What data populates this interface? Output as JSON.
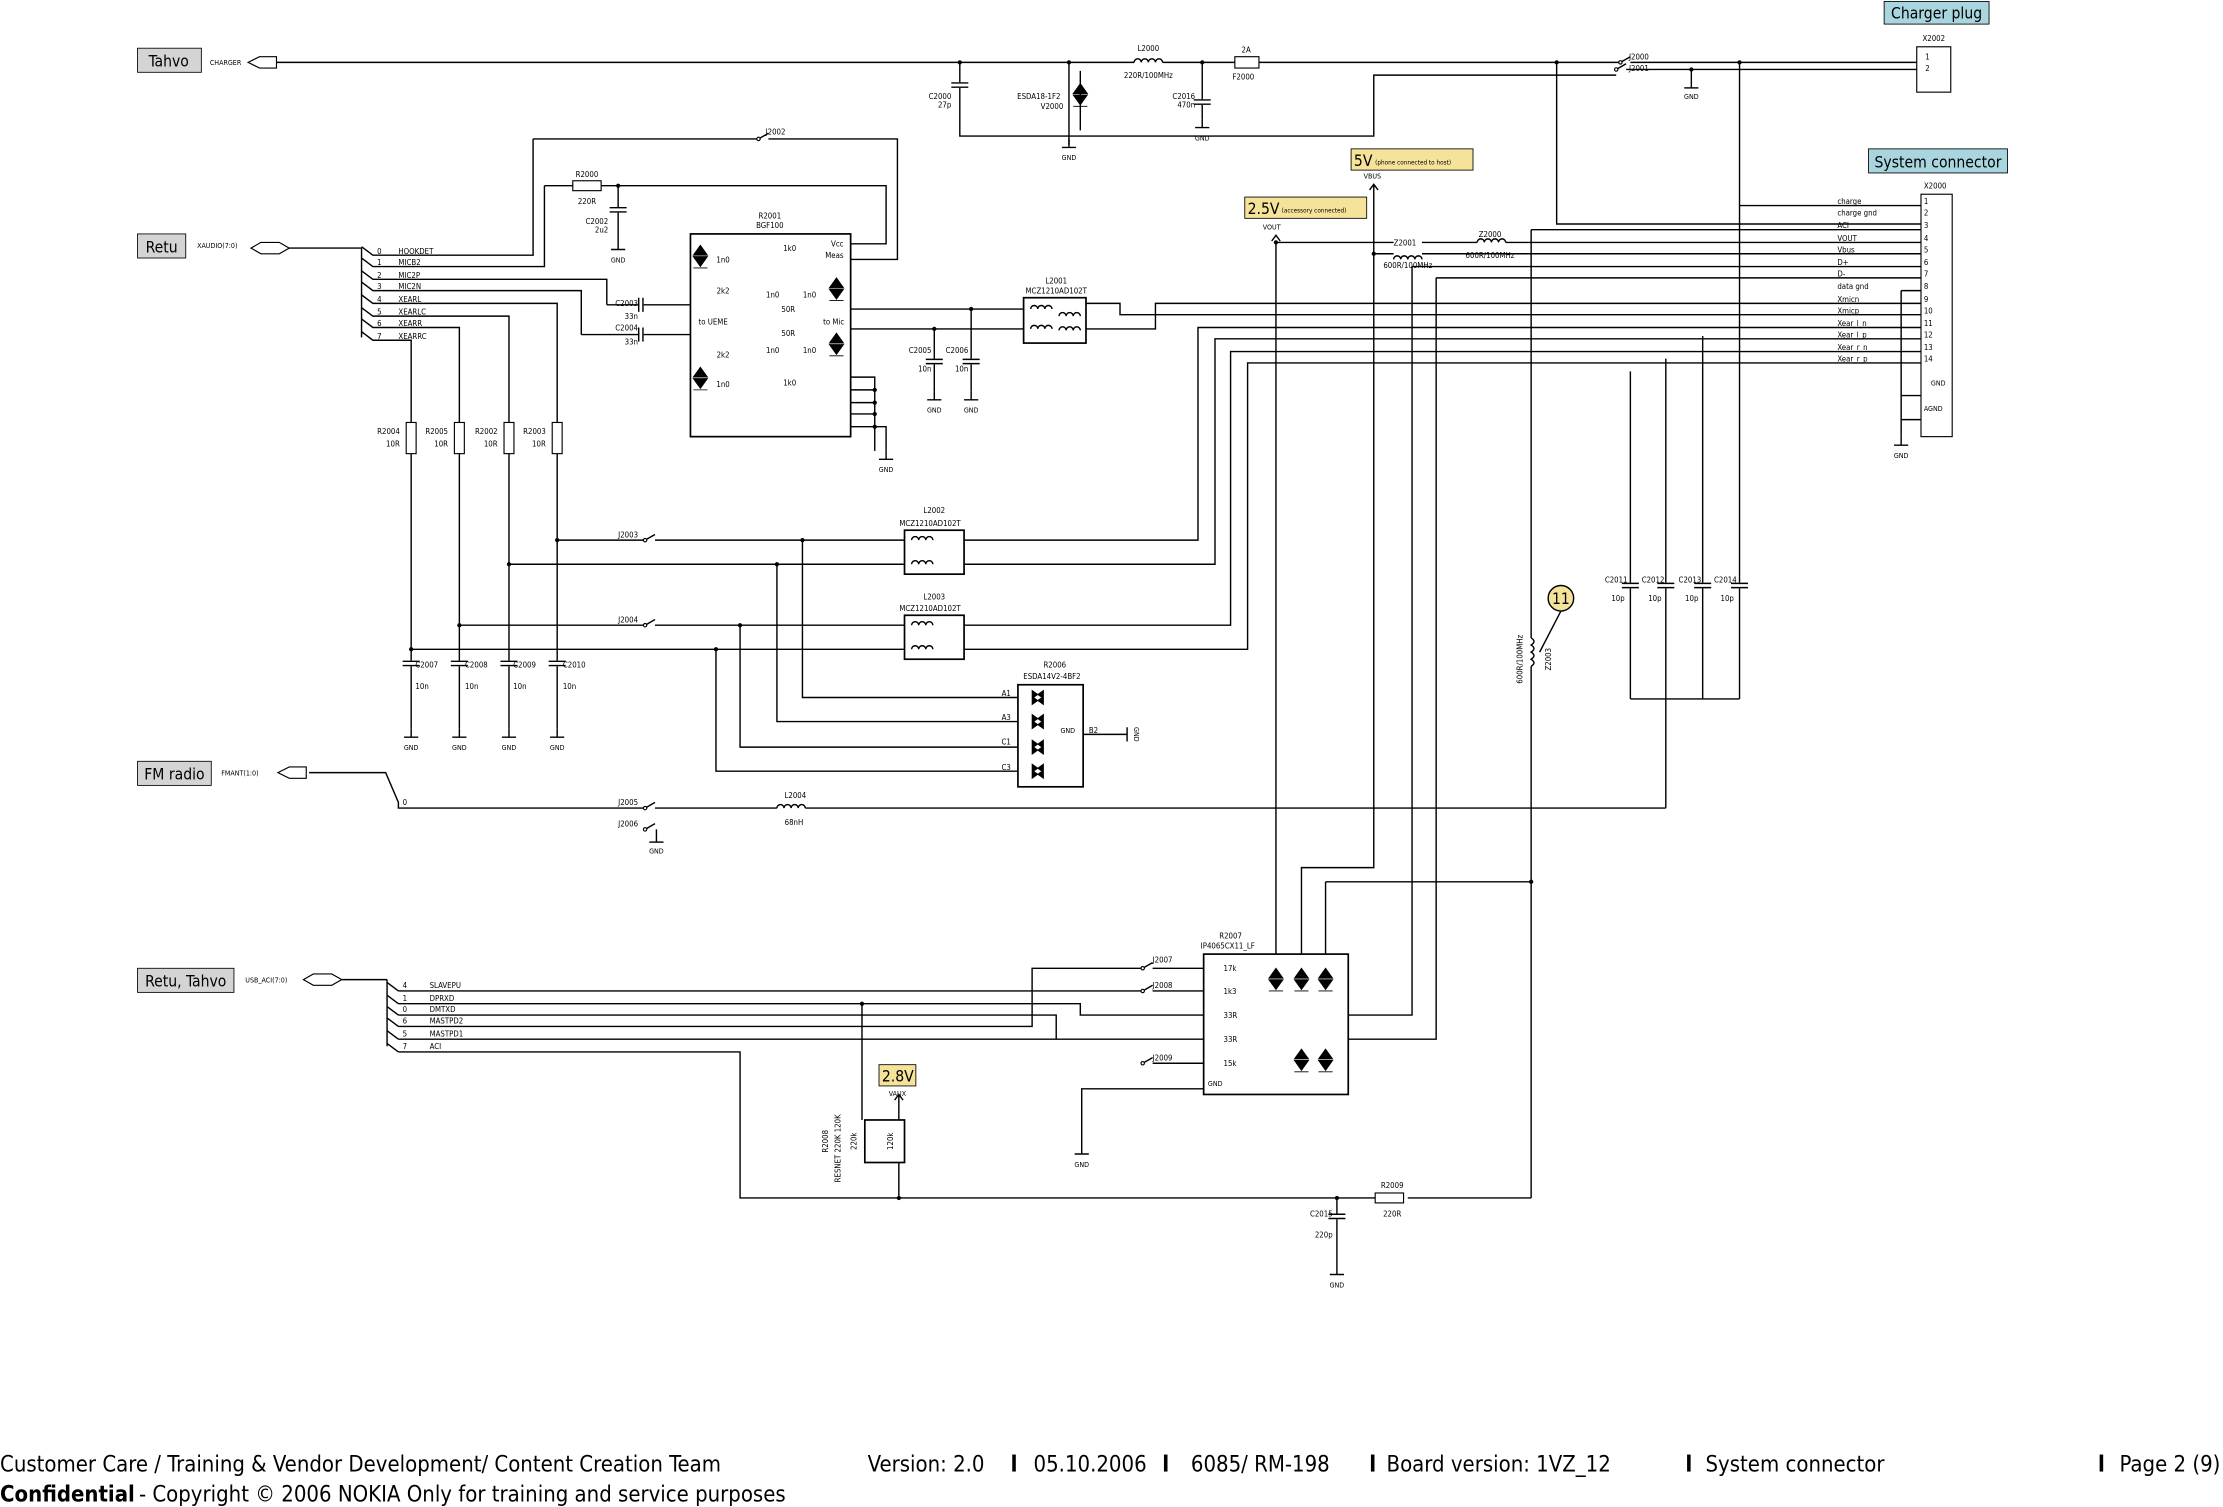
{
  "blocks": {
    "tahvo": "Tahvo",
    "retu": "Retu",
    "fm_radio": "FM radio",
    "retu_tahvo": "Retu, Tahvo"
  },
  "tags": {
    "charger_plug": "Charger plug",
    "system_connector": "System connector",
    "v5": "5V",
    "v5_note": "(phone connected to host)",
    "v25": "2.5V",
    "v25_note": "(accessory connected)",
    "v28": "2.8V",
    "callout": "11"
  },
  "nets": {
    "charger": "CHARGER",
    "xaudio": "XAUDIO(7:0)",
    "fmant": "FMANT(1:0)",
    "usb_aci": "USB_ACI(7:0)",
    "vbus": "VBUS",
    "vout": "VOUT",
    "vaux": "VAUX",
    "gnd": "GND",
    "agnd": "AGND"
  },
  "xaudio_pins": [
    {
      "num": "0",
      "name": "HOOKDET"
    },
    {
      "num": "1",
      "name": "MICB2"
    },
    {
      "num": "2",
      "name": "MIC2P"
    },
    {
      "num": "3",
      "name": "MIC2N"
    },
    {
      "num": "4",
      "name": "XEARL"
    },
    {
      "num": "5",
      "name": "XEARLC"
    },
    {
      "num": "6",
      "name": "XEARR"
    },
    {
      "num": "7",
      "name": "XEARRC"
    }
  ],
  "usb_pins": [
    {
      "num": "4",
      "name": "SLAVEPU"
    },
    {
      "num": "1",
      "name": "DPRXD"
    },
    {
      "num": "0",
      "name": "DMTXD"
    },
    {
      "num": "6",
      "name": "MASTPD2"
    },
    {
      "num": "5",
      "name": "MASTPD1"
    },
    {
      "num": "7",
      "name": "ACI"
    }
  ],
  "fm_pin": "0",
  "x2000_pins": [
    {
      "num": "1",
      "name": "charge"
    },
    {
      "num": "2",
      "name": "charge gnd"
    },
    {
      "num": "3",
      "name": "ACI"
    },
    {
      "num": "4",
      "name": "VOUT"
    },
    {
      "num": "5",
      "name": "Vbus"
    },
    {
      "num": "6",
      "name": "D+"
    },
    {
      "num": "7",
      "name": "D-"
    },
    {
      "num": "8",
      "name": "data gnd"
    },
    {
      "num": "9",
      "name": "Xmicn"
    },
    {
      "num": "10",
      "name": "Xmicp"
    },
    {
      "num": "11",
      "name": "Xear_l_n"
    },
    {
      "num": "12",
      "name": "Xear_l_p"
    },
    {
      "num": "13",
      "name": "Xear_r_n"
    },
    {
      "num": "14",
      "name": "Xear_r_p"
    }
  ],
  "x2002_pins": [
    "1",
    "2"
  ],
  "components": {
    "x2002": {
      "ref": "X2002"
    },
    "x2000": {
      "ref": "X2000"
    },
    "l2000": {
      "ref": "L2000",
      "value": "220R/100MHz"
    },
    "f2000": {
      "ref": "F2000",
      "value": "2A"
    },
    "c2000": {
      "ref": "C2000",
      "value": "27p"
    },
    "v2000": {
      "ref": "V2000",
      "value": "ESDA18-1F2"
    },
    "c2016": {
      "ref": "C2016",
      "value": "470n"
    },
    "j2000": {
      "ref": "J2000"
    },
    "j2001": {
      "ref": "J2001"
    },
    "j2002": {
      "ref": "J2002"
    },
    "r2000": {
      "ref": "R2000",
      "value": "220R"
    },
    "c2002": {
      "ref": "C2002",
      "value": "2u2"
    },
    "r2001": {
      "ref": "R2001",
      "value": "BGF100",
      "vcc": "Vcc",
      "meas": "Meas",
      "r1k0": "1k0",
      "r2k2": "2k2",
      "c1n0": "1n0",
      "r50": "50R",
      "to_ueme": "to UEME",
      "to_mic": "to Mic"
    },
    "c2003": {
      "ref": "C2003",
      "value": "33n"
    },
    "c2004": {
      "ref": "C2004",
      "value": "33n"
    },
    "l2001": {
      "ref": "L2001",
      "value": "MCZ1210AD102T"
    },
    "c2005": {
      "ref": "C2005",
      "value": "10n"
    },
    "c2006": {
      "ref": "C2006",
      "value": "10n"
    },
    "z2001": {
      "ref": "Z2001",
      "value": "600R/100MHz"
    },
    "z2000": {
      "ref": "Z2000",
      "value": "600R/100MHz"
    },
    "z2003": {
      "ref": "Z2003",
      "value": "600R/100MHz"
    },
    "r2004": {
      "ref": "R2004",
      "value": "10R"
    },
    "r2005": {
      "ref": "R2005",
      "value": "10R"
    },
    "r2002": {
      "ref": "R2002",
      "value": "10R"
    },
    "r2003": {
      "ref": "R2003",
      "value": "10R"
    },
    "l2002": {
      "ref": "L2002",
      "value": "MCZ1210AD102T"
    },
    "l2003": {
      "ref": "L2003",
      "value": "MCZ1210AD102T"
    },
    "j2003": {
      "ref": "J2003"
    },
    "j2004": {
      "ref": "J2004"
    },
    "c2007": {
      "ref": "C2007",
      "value": "10n"
    },
    "c2008": {
      "ref": "C2008",
      "value": "10n"
    },
    "c2009": {
      "ref": "C2009",
      "value": "10n"
    },
    "c2010": {
      "ref": "C2010",
      "value": "10n"
    },
    "r2006": {
      "ref": "R2006",
      "value": "ESDA14V2-4BF2",
      "a1": "A1",
      "a3": "A3",
      "c1": "C1",
      "c3": "C3",
      "b2": "B2"
    },
    "c2011": {
      "ref": "C2011",
      "value": "10p"
    },
    "c2012": {
      "ref": "C2012",
      "value": "10p"
    },
    "c2013": {
      "ref": "C2013",
      "value": "10p"
    },
    "c2014": {
      "ref": "C2014",
      "value": "10p"
    },
    "j2005": {
      "ref": "J2005"
    },
    "j2006": {
      "ref": "J2006"
    },
    "l2004": {
      "ref": "L2004",
      "value": "68nH"
    },
    "r2007": {
      "ref": "R2007",
      "value": "IP4065CX11_LF",
      "r17k": "17k",
      "r1k3": "1k3",
      "r33a": "33R",
      "r33b": "33R",
      "r15k": "15k"
    },
    "j2007": {
      "ref": "J2007"
    },
    "j2008": {
      "ref": "J2008"
    },
    "j2009": {
      "ref": "J2009"
    },
    "r2008": {
      "ref": "R2008",
      "value": "RESNET 220K 120K",
      "ra": "220k",
      "rb": "120k"
    },
    "c2015": {
      "ref": "C2015",
      "value": "220p"
    },
    "r2009": {
      "ref": "R2009",
      "value": "220R"
    }
  },
  "footer": {
    "team": "Customer Care / Training & Vendor Development/ Content Creation Team",
    "version": "Version: 2.0",
    "date": "05.10.2006",
    "model": "6085/ RM-198",
    "board": "Board version: 1VZ_12",
    "section": "System connector",
    "page": "Page 2 (9)",
    "confidential": "Confidential",
    "copyright": " - Copyright © 2006 NOKIA   Only for training and service purposes"
  }
}
